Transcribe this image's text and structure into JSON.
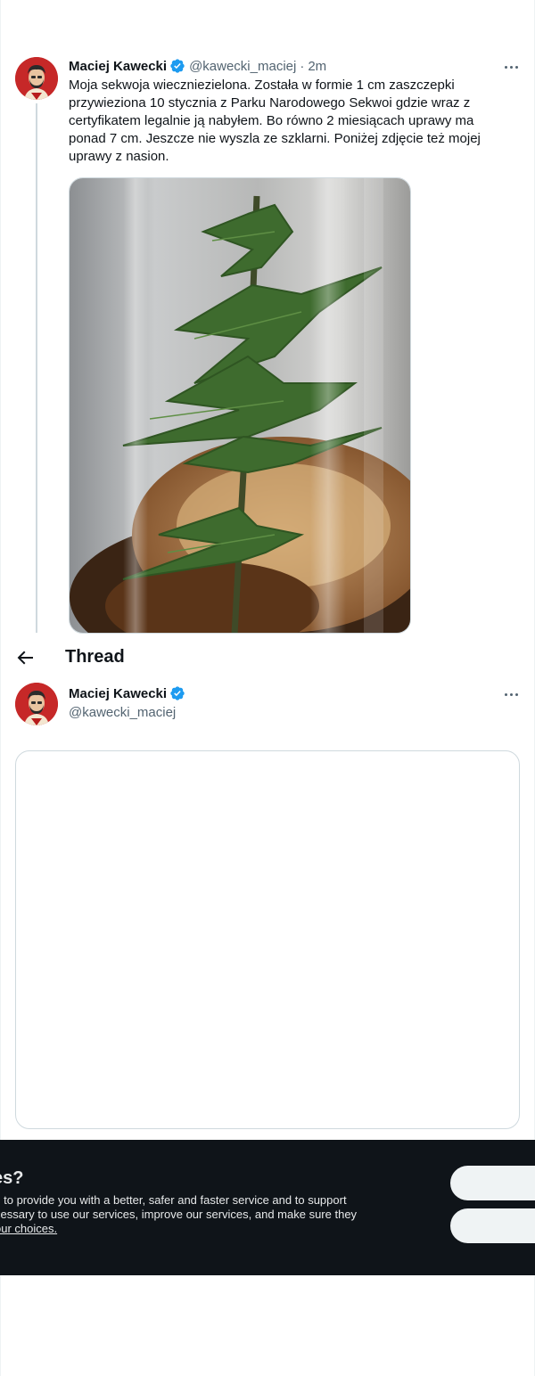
{
  "tweet": {
    "author_name": "Maciej Kawecki",
    "handle": "@kawecki_maciej",
    "separator": "·",
    "time": "2m",
    "text": "Moja sekwoja wiecznie­zielona. Została w formie 1 cm zaszczepki przywieziona 10 stycznia z Parku Narodowego Sekwoi gdzie wraz z certyfikatem legalnie ją nabyłem. Bo równo 2 miesiącach uprawy ma ponad 7 cm. Jeszcze nie wyszla ze szklarni. Poniżej zdjęcie też mojej uprawy z nasion."
  },
  "thread": {
    "title": "Thread",
    "author_name": "Maciej Kawecki",
    "handle": "@kawecki_maciej"
  },
  "cookie_banner": {
    "title": "es?",
    "text": "s to provide you with a better, safer and faster service and to support",
    "text2": "cessary to use our services, improve our services, and make sure they",
    "link": "our choices."
  },
  "icons": {
    "verified": "verified-badge-icon",
    "more": "more-horizontal-icon",
    "back": "arrow-left-icon"
  },
  "colors": {
    "accent": "#1d9bf0",
    "text": "#0f1419",
    "secondary": "#536471",
    "banner": "#0f1419"
  }
}
